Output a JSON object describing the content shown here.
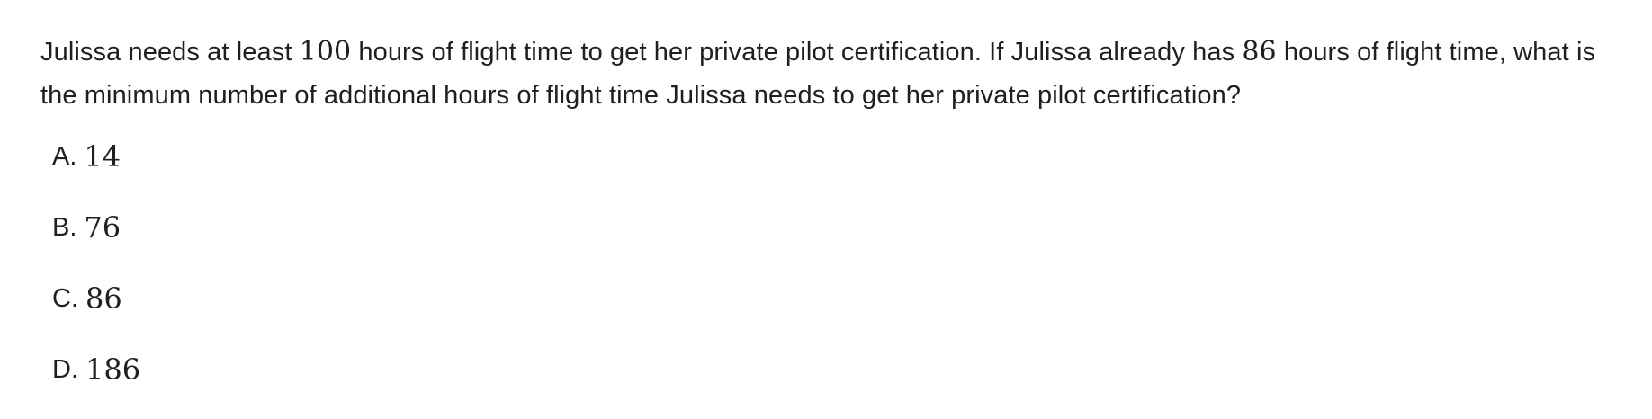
{
  "question": {
    "part1": "Julissa needs at least ",
    "math1": "100",
    "part2": " hours of flight time to get her private pilot certification. If Julissa already has ",
    "math2": "86",
    "part3": " hours of flight time, what is the minimum number of additional hours of flight time Julissa needs to get her private pilot certification?"
  },
  "choices": [
    {
      "letter": "A.",
      "value": "14"
    },
    {
      "letter": "B.",
      "value": "76"
    },
    {
      "letter": "C.",
      "value": "86"
    },
    {
      "letter": "D.",
      "value": "186"
    }
  ]
}
